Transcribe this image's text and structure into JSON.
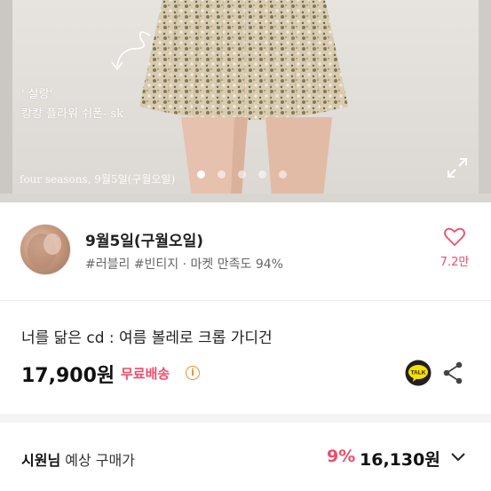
{
  "hero": {
    "caption_line1": "' 살랑'",
    "caption_line2": "캉캉 플라워 쉬폰- sk",
    "footer_text": "four seasons, 9월5일(구월오일)",
    "dots_count": 5,
    "active_dot": 1,
    "expand_icon": "expand-icon"
  },
  "seller": {
    "name": "9월5일(구월오일)",
    "tags": "#러블리 #빈티지 · 마켓 만족도 94%",
    "like_count": "7.2만",
    "like_icon": "heart-icon"
  },
  "product": {
    "title": "너를 닮은 cd : 여름 볼레로 크롭 가디건",
    "price": "17,900원",
    "shipping": "무료배송",
    "info_glyph": "i",
    "talk_label": "TALK"
  },
  "expected": {
    "user": "시원님",
    "label": " 예상 구매가",
    "discount": "9%",
    "price": "16,130원"
  },
  "colors": {
    "accent": "#ef4d6b",
    "info": "#ef8c2e",
    "talk_bg": "#231f20",
    "talk_yellow": "#f9e000"
  }
}
